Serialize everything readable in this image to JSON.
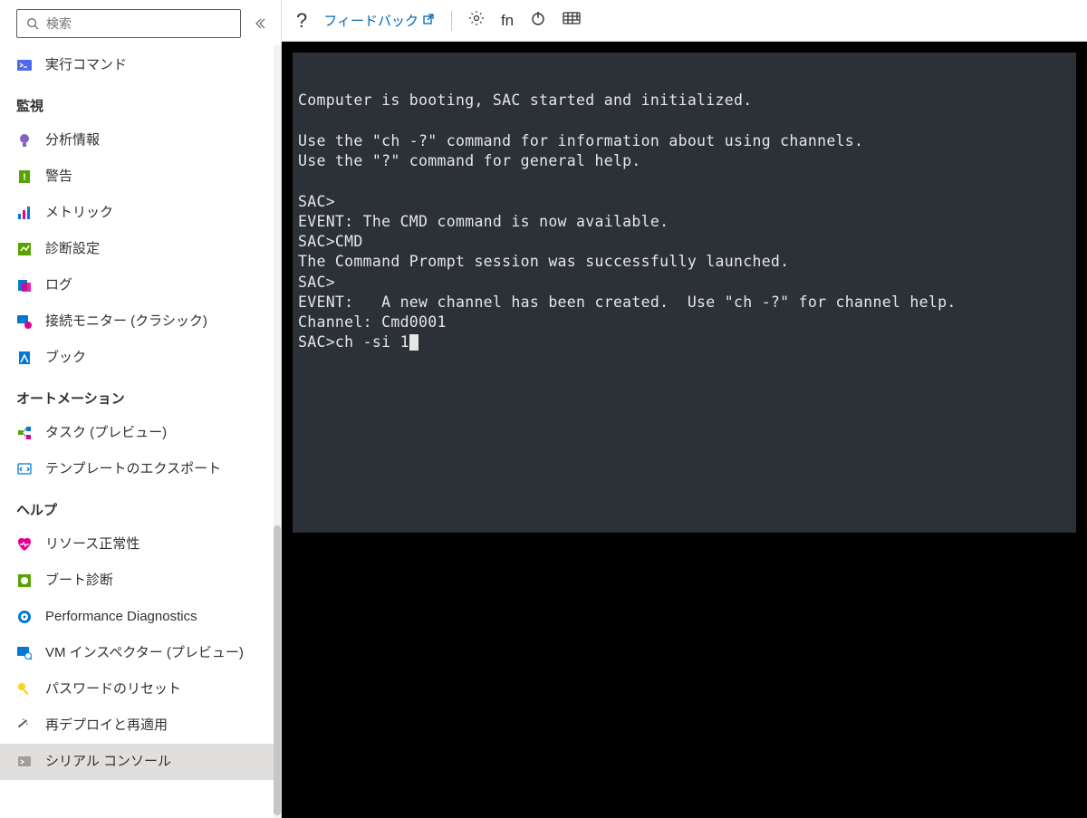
{
  "search": {
    "placeholder": "検索"
  },
  "sidebar": {
    "top_item": {
      "label": "実行コマンド"
    },
    "sections": [
      {
        "header": "監視",
        "items": [
          {
            "label": "分析情報",
            "icon": "insights-icon"
          },
          {
            "label": "警告",
            "icon": "alert-icon"
          },
          {
            "label": "メトリック",
            "icon": "metrics-icon"
          },
          {
            "label": "診断設定",
            "icon": "diagnostics-icon"
          },
          {
            "label": "ログ",
            "icon": "logs-icon"
          },
          {
            "label": "接続モニター (クラシック)",
            "icon": "connection-monitor-icon"
          },
          {
            "label": "ブック",
            "icon": "workbook-icon"
          }
        ]
      },
      {
        "header": "オートメーション",
        "items": [
          {
            "label": "タスク (プレビュー)",
            "icon": "tasks-icon"
          },
          {
            "label": "テンプレートのエクスポート",
            "icon": "template-export-icon"
          }
        ]
      },
      {
        "header": "ヘルプ",
        "items": [
          {
            "label": "リソース正常性",
            "icon": "health-icon"
          },
          {
            "label": "ブート診断",
            "icon": "boot-diagnostics-icon"
          },
          {
            "label": "Performance Diagnostics",
            "icon": "performance-icon"
          },
          {
            "label": "VM インスペクター (プレビュー)",
            "icon": "vm-inspector-icon"
          },
          {
            "label": "パスワードのリセット",
            "icon": "password-reset-icon"
          },
          {
            "label": "再デプロイと再適用",
            "icon": "redeploy-icon"
          },
          {
            "label": "シリアル コンソール",
            "icon": "serial-console-icon",
            "selected": true
          }
        ]
      }
    ]
  },
  "toolbar": {
    "help": "?",
    "feedback": "フィードバック",
    "fn": "fn"
  },
  "terminal": {
    "lines": [
      "",
      "Computer is booting, SAC started and initialized.",
      "",
      "Use the \"ch -?\" command for information about using channels.",
      "Use the \"?\" command for general help.",
      "",
      "SAC>",
      "EVENT: The CMD command is now available.",
      "SAC>CMD",
      "The Command Prompt session was successfully launched.",
      "SAC>",
      "EVENT:   A new channel has been created.  Use \"ch -?\" for channel help.",
      "Channel: Cmd0001",
      "SAC>ch -si 1"
    ]
  }
}
